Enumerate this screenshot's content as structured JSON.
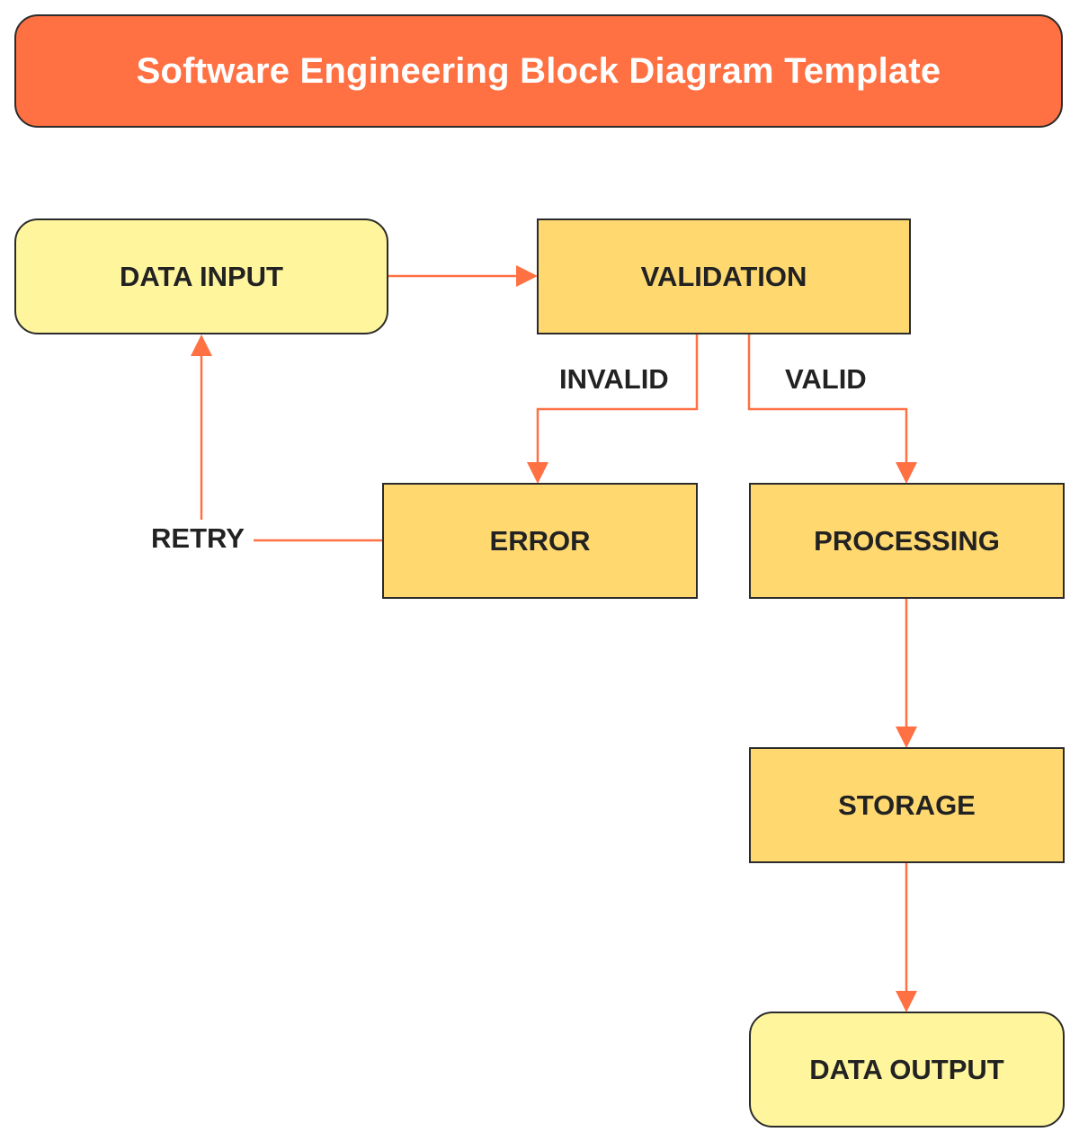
{
  "title": "Software Engineering Block Diagram Template",
  "colors": {
    "title_bg": "#ff7043",
    "terminal_fill": "#fff59d",
    "process_fill": "#ffd970",
    "connector": "#ff7043",
    "border": "#2b2b2b"
  },
  "nodes": {
    "data_input": "DATA INPUT",
    "validation": "VALIDATION",
    "error": "ERROR",
    "processing": "PROCESSING",
    "storage": "STORAGE",
    "data_output": "DATA OUTPUT"
  },
  "edge_labels": {
    "invalid": "INVALID",
    "valid": "VALID",
    "retry": "RETRY"
  },
  "edges": [
    {
      "from": "data_input",
      "to": "validation",
      "label": ""
    },
    {
      "from": "validation",
      "to": "error",
      "label": "INVALID"
    },
    {
      "from": "validation",
      "to": "processing",
      "label": "VALID"
    },
    {
      "from": "error",
      "to": "data_input",
      "label": "RETRY"
    },
    {
      "from": "processing",
      "to": "storage",
      "label": ""
    },
    {
      "from": "storage",
      "to": "data_output",
      "label": ""
    }
  ]
}
